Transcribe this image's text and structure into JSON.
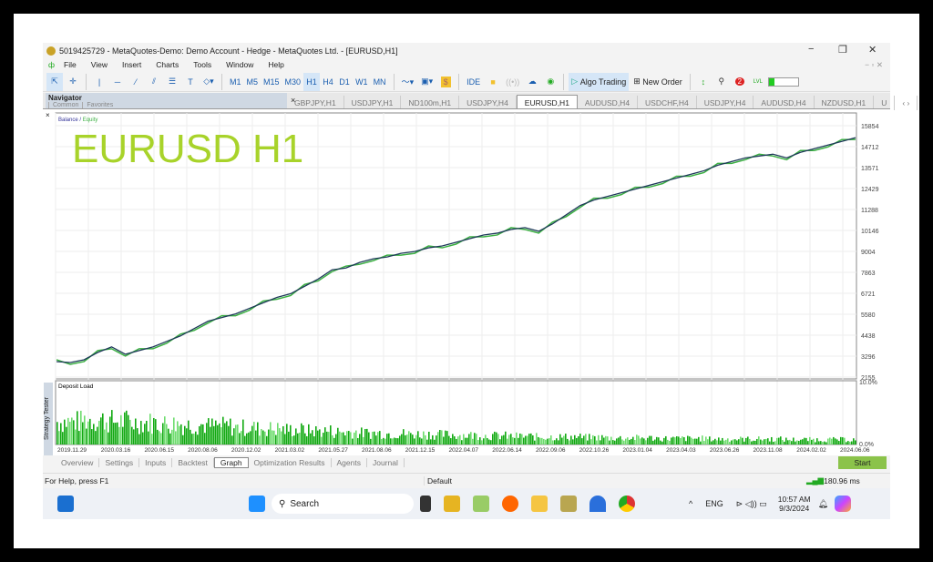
{
  "window": {
    "title": "5019425729 - MetaQuotes-Demo: Demo Account - Hedge - MetaQuotes Ltd. - [EURUSD,H1]"
  },
  "menu": [
    "File",
    "View",
    "Insert",
    "Charts",
    "Tools",
    "Window",
    "Help"
  ],
  "toolbar": {
    "timeframes": [
      "M1",
      "M5",
      "M15",
      "M30",
      "H1",
      "H4",
      "D1",
      "W1",
      "MN"
    ],
    "active_timeframe": "H1",
    "ide": "IDE",
    "algo_trading": "Algo Trading",
    "new_order": "New Order",
    "notifications": "2",
    "lvl": "LVL"
  },
  "navigator": {
    "title": "Navigator",
    "tabs": [
      "Common",
      "Favorites"
    ]
  },
  "chart_tabs": [
    "GBPJPY,H1",
    "USDJPY,H1",
    "ND100m,H1",
    "USDJPY,H4",
    "EURUSD,H1",
    "AUDUSD,H4",
    "USDCHF,H4",
    "USDJPY,H4",
    "AUDUSD,H4",
    "NZDUSD,H1",
    "U"
  ],
  "active_chart_tab": "EURUSD,H1",
  "chart_data": {
    "type": "line",
    "watermark": "EURUSD H1",
    "legend": {
      "balance": "Balance",
      "sep": " / ",
      "equity": "Equity"
    },
    "y_ticks": [
      15854,
      14712,
      13571,
      12429,
      11288,
      10146,
      9004,
      7863,
      6721,
      5580,
      4438,
      3296,
      2155
    ],
    "ylim": [
      2155,
      15854
    ],
    "x_ticks": [
      "2019.11.29",
      "2020.03.16",
      "2020.06.15",
      "2020.08.06",
      "2020.12.02",
      "2021.03.02",
      "2021.05.27",
      "2021.08.06",
      "2021.12.15",
      "2022.04.07",
      "2022.06.14",
      "2022.09.06",
      "2022.10.26",
      "2023.01.04",
      "2023.04.03",
      "2023.06.26",
      "2023.11.08",
      "2024.02.02",
      "2024.06.06"
    ],
    "balance": [
      3000,
      2950,
      3100,
      3500,
      3800,
      3400,
      3600,
      3800,
      4100,
      4400,
      4800,
      5200,
      5400,
      5600,
      5900,
      6200,
      6500,
      6700,
      7100,
      7500,
      8000,
      8100,
      8400,
      8600,
      8700,
      8900,
      9000,
      9200,
      9300,
      9500,
      9700,
      9900,
      10000,
      10200,
      10300,
      10100,
      10500,
      11000,
      11500,
      11800,
      12000,
      12200,
      12400,
      12600,
      12800,
      13000,
      13200,
      13400,
      13700,
      13900,
      14100,
      14200,
      14300,
      14100,
      14400,
      14600,
      14800,
      15000,
      15200
    ],
    "balance_color": "#1f3a5a",
    "equity_color": "#3cb043",
    "deposit_load": {
      "title": "Deposit Load",
      "ylim_labels": [
        "10.0%",
        "0.0%"
      ],
      "levels_percent": [
        4.2,
        4.5,
        4.3,
        4.0,
        3.8,
        3.6,
        3.4,
        3.1,
        2.9,
        2.7,
        2.5,
        2.3,
        2.1,
        2.0,
        1.9,
        1.8,
        1.7,
        1.6,
        1.5,
        1.4,
        1.4,
        1.3,
        1.2,
        1.2,
        1.1,
        1.1,
        1.0,
        1.0,
        1.0,
        0.9,
        0.9,
        0.9
      ],
      "color": "#11a911"
    }
  },
  "tester": {
    "side_label": "Strategy Tester",
    "tabs": [
      "Overview",
      "Settings",
      "Inputs",
      "Backtest",
      "Graph",
      "Optimization Results",
      "Agents",
      "Journal"
    ],
    "active": "Graph",
    "start": "Start"
  },
  "status": {
    "help": "For Help, press F1",
    "profile": "Default",
    "ping": "180.96 ms"
  },
  "taskbar": {
    "search": "Search",
    "lang": "ENG",
    "time": "10:57 AM",
    "date": "9/3/2024"
  }
}
